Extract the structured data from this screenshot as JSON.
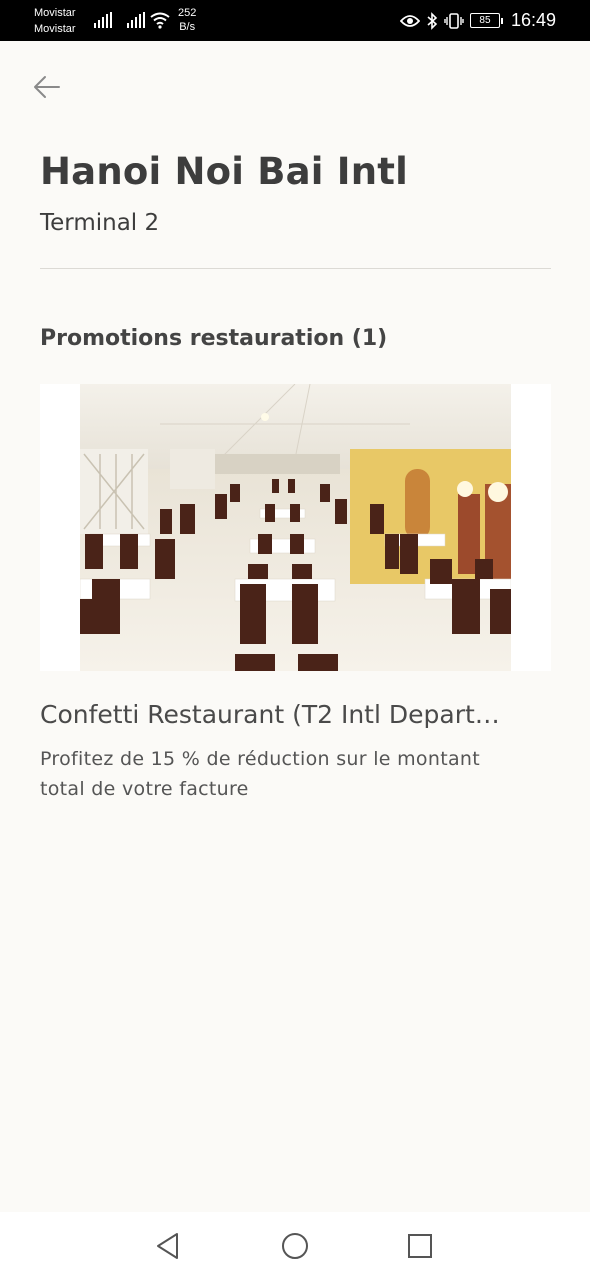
{
  "status_bar": {
    "carrier_1": "Movistar",
    "carrier_2": "Movistar",
    "net_speed_value": "252",
    "net_speed_unit": "B/s",
    "battery_level": "85",
    "time": "16:49",
    "icons": [
      "signal-icon",
      "signal-icon",
      "wifi-icon",
      "eye-icon",
      "bluetooth-icon",
      "vibrate-icon",
      "battery-icon"
    ]
  },
  "header": {
    "back_icon": "arrow-left-icon",
    "title": "Hanoi Noi Bai Intl",
    "subtitle": "Terminal 2"
  },
  "section": {
    "heading": "Promotions restauration (1)"
  },
  "promotions": [
    {
      "name": "Confetti Restaurant (T2 Intl Depart…",
      "description": "Profitez de 15 % de réduction sur le montant total de votre facture",
      "image": "restaurant-dining-hall-photo"
    }
  ],
  "nav_bar": {
    "icons": [
      "back-triangle-icon",
      "home-circle-icon",
      "recents-square-icon"
    ]
  },
  "colors": {
    "background": "#fbfaf7",
    "text_primary": "#3d3d3d",
    "divider": "#dcdad5"
  }
}
